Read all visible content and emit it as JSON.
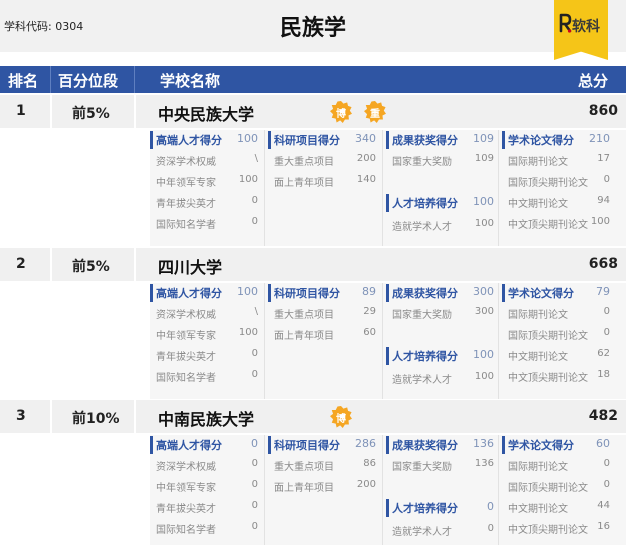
{
  "discipline_code": "学科代码: 0304",
  "page_title": "民族学",
  "logo_text": "软科",
  "header": {
    "rank": "排名",
    "percentile": "百分位段",
    "school": "学校名称",
    "total": "总分"
  },
  "schools": [
    {
      "rank": "1",
      "percentile": "前5%",
      "name": "中央民族大学",
      "total": "860",
      "badges": [
        "博",
        "重"
      ],
      "talent": {
        "label": "高端人才得分",
        "value": "100",
        "items": [
          {
            "label": "资深学术权威",
            "value": "\\"
          },
          {
            "label": "中年领军专家",
            "value": "100"
          },
          {
            "label": "青年拔尖英才",
            "value": "0"
          },
          {
            "label": "国际知名学者",
            "value": "0"
          }
        ]
      },
      "research": {
        "label": "科研项目得分",
        "value": "340",
        "items": [
          {
            "label": "重大重点项目",
            "value": "200"
          },
          {
            "label": "面上青年项目",
            "value": "140"
          }
        ]
      },
      "award": {
        "label": "成果获奖得分",
        "value": "109",
        "items": [
          {
            "label": "国家重大奖励",
            "value": "109"
          }
        ]
      },
      "cultivation": {
        "label": "人才培养得分",
        "value": "100",
        "items": [
          {
            "label": "造就学术人才",
            "value": "100"
          }
        ]
      },
      "paper": {
        "label": "学术论文得分",
        "value": "210",
        "items": [
          {
            "label": "国际期刊论文",
            "value": "17"
          },
          {
            "label": "国际顶尖期刊论文",
            "value": "0"
          },
          {
            "label": "中文期刊论文",
            "value": "94"
          },
          {
            "label": "中文顶尖期刊论文",
            "value": "100"
          }
        ]
      }
    },
    {
      "rank": "2",
      "percentile": "前5%",
      "name": "四川大学",
      "total": "668",
      "badges": [],
      "talent": {
        "label": "高端人才得分",
        "value": "100",
        "items": [
          {
            "label": "资深学术权威",
            "value": "\\"
          },
          {
            "label": "中年领军专家",
            "value": "100"
          },
          {
            "label": "青年拔尖英才",
            "value": "0"
          },
          {
            "label": "国际知名学者",
            "value": "0"
          }
        ]
      },
      "research": {
        "label": "科研项目得分",
        "value": "89",
        "items": [
          {
            "label": "重大重点项目",
            "value": "29"
          },
          {
            "label": "面上青年项目",
            "value": "60"
          }
        ]
      },
      "award": {
        "label": "成果获奖得分",
        "value": "300",
        "items": [
          {
            "label": "国家重大奖励",
            "value": "300"
          }
        ]
      },
      "cultivation": {
        "label": "人才培养得分",
        "value": "100",
        "items": [
          {
            "label": "造就学术人才",
            "value": "100"
          }
        ]
      },
      "paper": {
        "label": "学术论文得分",
        "value": "79",
        "items": [
          {
            "label": "国际期刊论文",
            "value": "0"
          },
          {
            "label": "国际顶尖期刊论文",
            "value": "0"
          },
          {
            "label": "中文期刊论文",
            "value": "62"
          },
          {
            "label": "中文顶尖期刊论文",
            "value": "18"
          }
        ]
      }
    },
    {
      "rank": "3",
      "percentile": "前10%",
      "name": "中南民族大学",
      "total": "482",
      "badges": [
        "博"
      ],
      "talent": {
        "label": "高端人才得分",
        "value": "0",
        "items": [
          {
            "label": "资深学术权威",
            "value": "0"
          },
          {
            "label": "中年领军专家",
            "value": "0"
          },
          {
            "label": "青年拔尖英才",
            "value": "0"
          },
          {
            "label": "国际知名学者",
            "value": "0"
          }
        ]
      },
      "research": {
        "label": "科研项目得分",
        "value": "286",
        "items": [
          {
            "label": "重大重点项目",
            "value": "86"
          },
          {
            "label": "面上青年项目",
            "value": "200"
          }
        ]
      },
      "award": {
        "label": "成果获奖得分",
        "value": "136",
        "items": [
          {
            "label": "国家重大奖励",
            "value": "136"
          }
        ]
      },
      "cultivation": {
        "label": "人才培养得分",
        "value": "0",
        "items": [
          {
            "label": "造就学术人才",
            "value": "0"
          }
        ]
      },
      "paper": {
        "label": "学术论文得分",
        "value": "60",
        "items": [
          {
            "label": "国际期刊论文",
            "value": "0"
          },
          {
            "label": "国际顶尖期刊论文",
            "value": "0"
          },
          {
            "label": "中文期刊论文",
            "value": "44"
          },
          {
            "label": "中文顶尖期刊论文",
            "value": "16"
          }
        ]
      }
    }
  ]
}
